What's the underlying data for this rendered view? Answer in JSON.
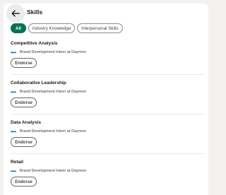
{
  "header": {
    "title": "Skills"
  },
  "filters": [
    "All",
    "Industry Knowledge",
    "Interpersonal Skills"
  ],
  "skills": [
    {
      "name": "Competitive Analysis",
      "experience": "Brand Development Intern at Daymon",
      "endorse_label": "Endorse"
    },
    {
      "name": "Collaborative Leadership",
      "experience": "Brand Development Intern at Daymon",
      "endorse_label": "Endorse"
    },
    {
      "name": "Data Analysis",
      "experience": "Brand Development Intern at Daymon",
      "endorse_label": "Endorse"
    },
    {
      "name": "Retail",
      "experience": "Brand Development Intern at Daymon",
      "endorse_label": "Endorse"
    }
  ],
  "icons": {
    "back": "arrow-left-icon",
    "company_logo": "daymon-logo-icon"
  },
  "colors": {
    "active_filter": "#01754f",
    "logo": "#1f6fb2",
    "page_background": "#f4f2ee"
  }
}
